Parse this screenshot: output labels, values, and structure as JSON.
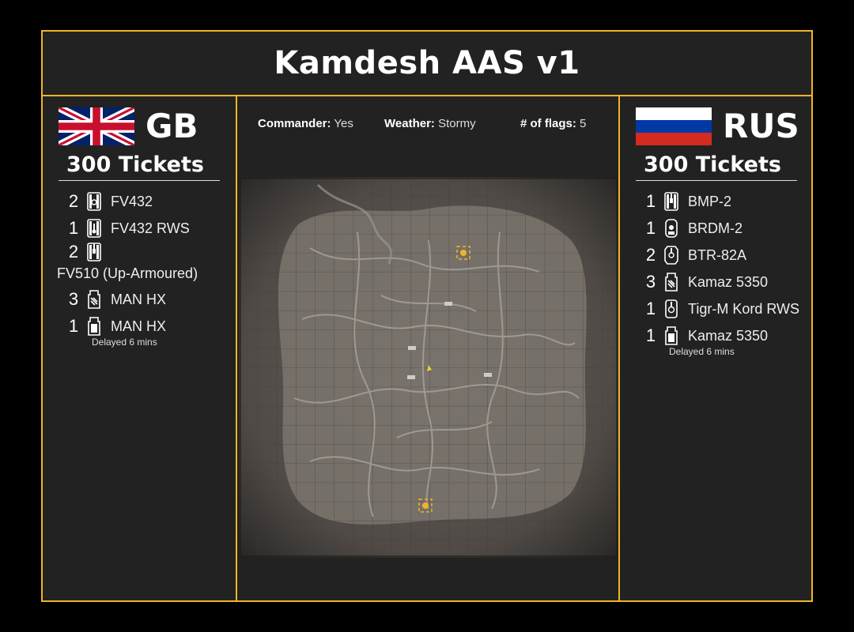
{
  "title": "Kamdesh AAS v1",
  "info": {
    "commander_label": "Commander:",
    "commander_value": "Yes",
    "weather_label": "Weather:",
    "weather_value": "Stormy",
    "flags_label": "# of flags:",
    "flags_value": "5"
  },
  "teams": {
    "left": {
      "name": "GB",
      "tickets": "300 Tickets",
      "vehicles": [
        {
          "count": "2",
          "name": "FV432",
          "icon": "apc-tracked-icon"
        },
        {
          "count": "1",
          "name": "FV432 RWS",
          "icon": "apc-rws-icon"
        },
        {
          "count": "2",
          "name": "FV510 (Up-Armoured)",
          "icon": "ifv-icon"
        },
        {
          "count": "3",
          "name": "MAN HX",
          "icon": "logistics-truck-icon"
        },
        {
          "count": "1",
          "name": "MAN HX",
          "icon": "transport-truck-icon"
        }
      ],
      "delayed_note": "Delayed 6 mins"
    },
    "right": {
      "name": "RUS",
      "tickets": "300 Tickets",
      "vehicles": [
        {
          "count": "1",
          "name": "BMP-2",
          "icon": "ifv-icon"
        },
        {
          "count": "1",
          "name": "BRDM-2",
          "icon": "scout-car-icon"
        },
        {
          "count": "2",
          "name": "BTR-82A",
          "icon": "apc-wheeled-icon"
        },
        {
          "count": "3",
          "name": "Kamaz 5350",
          "icon": "logistics-truck-icon"
        },
        {
          "count": "1",
          "name": "Tigr-M Kord RWS",
          "icon": "mrap-rws-icon"
        },
        {
          "count": "1",
          "name": "Kamaz 5350",
          "icon": "transport-truck-icon"
        }
      ],
      "delayed_note": "Delayed 6 mins"
    }
  },
  "colors": {
    "accent": "#f0b429",
    "panel": "#222222",
    "background": "#000000"
  }
}
